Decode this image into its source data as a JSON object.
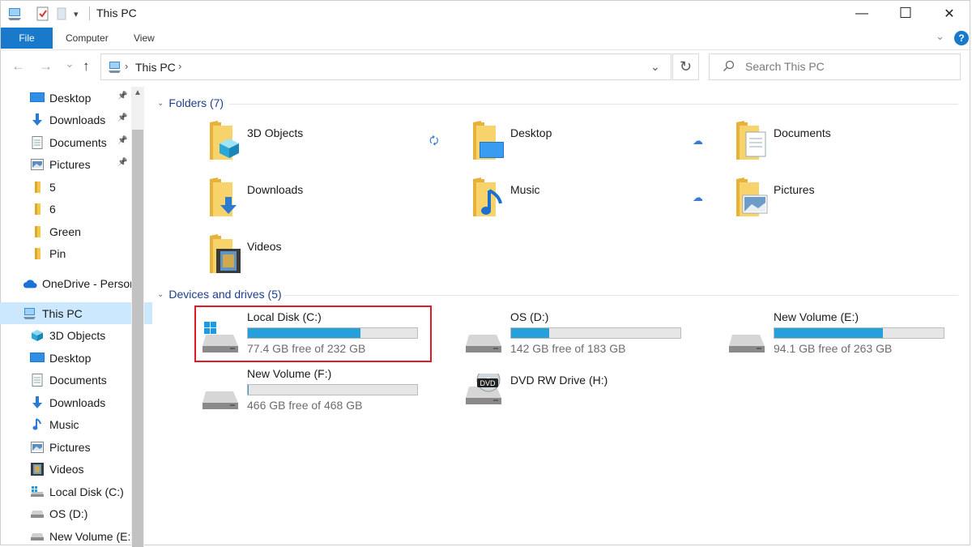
{
  "window": {
    "title": "This PC",
    "minimize": "—",
    "maximize": "☐",
    "close": "✕"
  },
  "ribbon": {
    "file_label": "File",
    "tabs": [
      "Computer",
      "View"
    ],
    "help": "?"
  },
  "nav": {
    "back": "←",
    "forward": "→",
    "recent": "⌄",
    "up": "↑",
    "breadcrumb": "This PC",
    "search_placeholder": "Search This PC"
  },
  "sidebar": {
    "items": [
      {
        "label": "Desktop",
        "icon": "desktop-icon",
        "pinned": true
      },
      {
        "label": "Downloads",
        "icon": "downloads-icon",
        "pinned": true
      },
      {
        "label": "Documents",
        "icon": "documents-icon",
        "pinned": true
      },
      {
        "label": "Pictures",
        "icon": "pictures-icon",
        "pinned": true
      },
      {
        "label": "5",
        "icon": "folder-icon",
        "pinned": false
      },
      {
        "label": "6",
        "icon": "folder-icon",
        "pinned": false
      },
      {
        "label": "Green",
        "icon": "folder-icon",
        "pinned": false
      },
      {
        "label": "Pin",
        "icon": "folder-icon",
        "pinned": false
      },
      {
        "label": "OneDrive - Person",
        "icon": "onedrive-icon",
        "pinned": false
      },
      {
        "label": "This PC",
        "icon": "this-pc-icon",
        "pinned": false,
        "selected": true
      },
      {
        "label": "3D Objects",
        "icon": "3d-objects-icon",
        "pinned": false
      },
      {
        "label": "Desktop",
        "icon": "desktop-icon",
        "pinned": false
      },
      {
        "label": "Documents",
        "icon": "documents-icon",
        "pinned": false
      },
      {
        "label": "Downloads",
        "icon": "downloads-icon",
        "pinned": false
      },
      {
        "label": "Music",
        "icon": "music-icon",
        "pinned": false
      },
      {
        "label": "Pictures",
        "icon": "pictures-icon",
        "pinned": false
      },
      {
        "label": "Videos",
        "icon": "videos-icon",
        "pinned": false
      },
      {
        "label": "Local Disk (C:)",
        "icon": "windows-drive-icon",
        "pinned": false
      },
      {
        "label": "OS (D:)",
        "icon": "drive-icon",
        "pinned": false
      },
      {
        "label": "New Volume (E:)",
        "icon": "drive-icon",
        "pinned": false
      }
    ]
  },
  "folders": {
    "header": "Folders (7)",
    "items": [
      {
        "name": "3D Objects",
        "icon": "3d-objects-folder-icon"
      },
      {
        "name": "Desktop",
        "icon": "desktop-folder-icon"
      },
      {
        "name": "Documents",
        "icon": "documents-folder-icon"
      },
      {
        "name": "Downloads",
        "icon": "downloads-folder-icon"
      },
      {
        "name": "Music",
        "icon": "music-folder-icon"
      },
      {
        "name": "Pictures",
        "icon": "pictures-folder-icon"
      },
      {
        "name": "Videos",
        "icon": "videos-folder-icon"
      }
    ]
  },
  "drives": {
    "header": "Devices and drives (5)",
    "items": [
      {
        "name": "Local Disk (C:)",
        "free_text": "77.4 GB free of 232 GB",
        "used_fraction": 0.666,
        "icon": "windows-drive-icon",
        "highlighted": true
      },
      {
        "name": "OS (D:)",
        "free_text": "142 GB free of 183 GB",
        "used_fraction": 0.224,
        "icon": "drive-icon"
      },
      {
        "name": "New Volume (E:)",
        "free_text": "94.1 GB free of 263 GB",
        "used_fraction": 0.642,
        "icon": "drive-icon"
      },
      {
        "name": "New Volume (F:)",
        "free_text": "466 GB free of 468 GB",
        "used_fraction": 0.004,
        "icon": "drive-icon"
      },
      {
        "name": "DVD RW Drive (H:)",
        "icon": "dvd-drive-icon"
      }
    ]
  },
  "colors": {
    "accent": "#1979ca",
    "bar_fill": "#26a0da",
    "highlight": "#e01b24",
    "folder": "#f3c84c"
  }
}
